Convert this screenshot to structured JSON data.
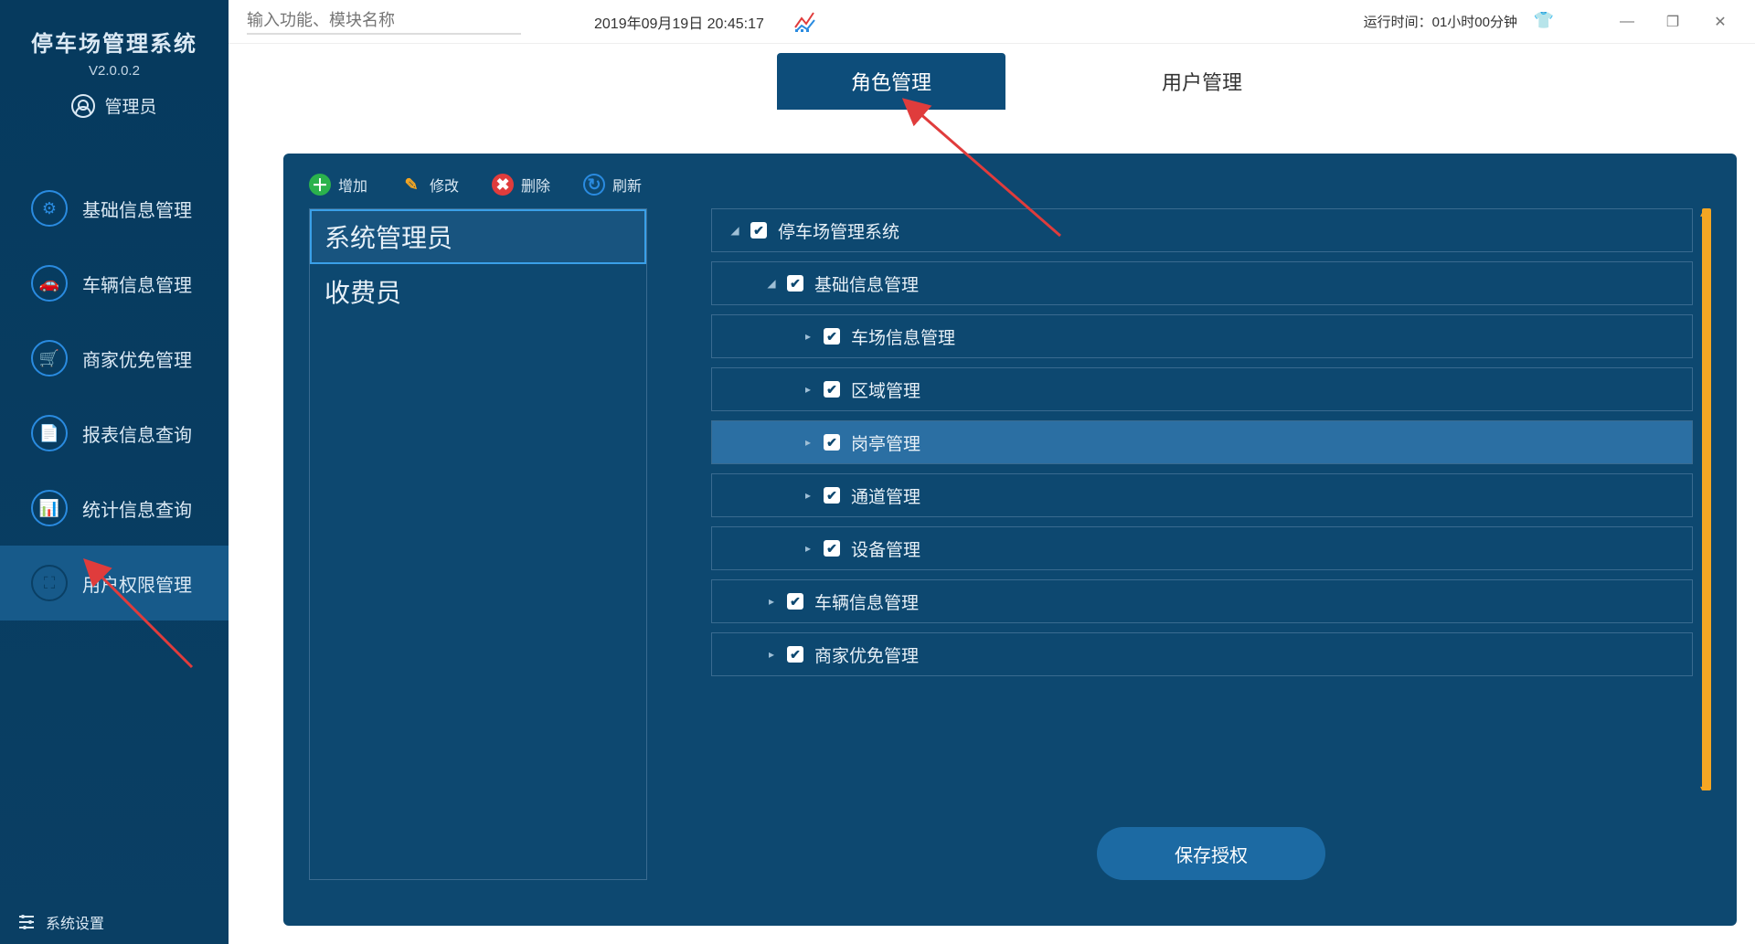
{
  "header": {
    "search_placeholder": "输入功能、模块名称",
    "datetime": "2019年09月19日 20:45:17",
    "runtime_label": "运行时间：",
    "runtime_value": "01小时00分钟"
  },
  "sidebar": {
    "title": "停车场管理系统",
    "version": "V2.0.0.2",
    "user": "管理员",
    "items": [
      {
        "label": "基础信息管理",
        "icon": "⚙"
      },
      {
        "label": "车辆信息管理",
        "icon": "🚗"
      },
      {
        "label": "商家优免管理",
        "icon": "🛒"
      },
      {
        "label": "报表信息查询",
        "icon": "📄"
      },
      {
        "label": "统计信息查询",
        "icon": "📊"
      },
      {
        "label": "用户权限管理",
        "icon": "⛶"
      }
    ],
    "active_index": 5,
    "footer": "系统设置"
  },
  "tabs": {
    "items": [
      {
        "label": "角色管理"
      },
      {
        "label": "用户管理"
      }
    ],
    "active_index": 0
  },
  "toolbar": {
    "add": "增加",
    "edit": "修改",
    "del": "删除",
    "refresh": "刷新"
  },
  "roles": {
    "items": [
      {
        "label": "系统管理员"
      },
      {
        "label": "收费员"
      }
    ],
    "selected_index": 0
  },
  "tree": {
    "nodes": [
      {
        "indent": 0,
        "expand": "down",
        "checked": true,
        "label": "停车场管理系统",
        "hl": false
      },
      {
        "indent": 1,
        "expand": "down",
        "checked": true,
        "label": "基础信息管理",
        "hl": false
      },
      {
        "indent": 2,
        "expand": "right",
        "checked": true,
        "label": "车场信息管理",
        "hl": false
      },
      {
        "indent": 2,
        "expand": "right",
        "checked": true,
        "label": "区域管理",
        "hl": false
      },
      {
        "indent": 2,
        "expand": "right",
        "checked": true,
        "label": "岗亭管理",
        "hl": true
      },
      {
        "indent": 2,
        "expand": "right",
        "checked": true,
        "label": "通道管理",
        "hl": false
      },
      {
        "indent": 2,
        "expand": "right",
        "checked": true,
        "label": "设备管理",
        "hl": false
      },
      {
        "indent": 1,
        "expand": "right",
        "checked": true,
        "label": "车辆信息管理",
        "hl": false
      },
      {
        "indent": 1,
        "expand": "right",
        "checked": true,
        "label": "商家优免管理",
        "hl": false
      }
    ]
  },
  "actions": {
    "save": "保存授权"
  }
}
